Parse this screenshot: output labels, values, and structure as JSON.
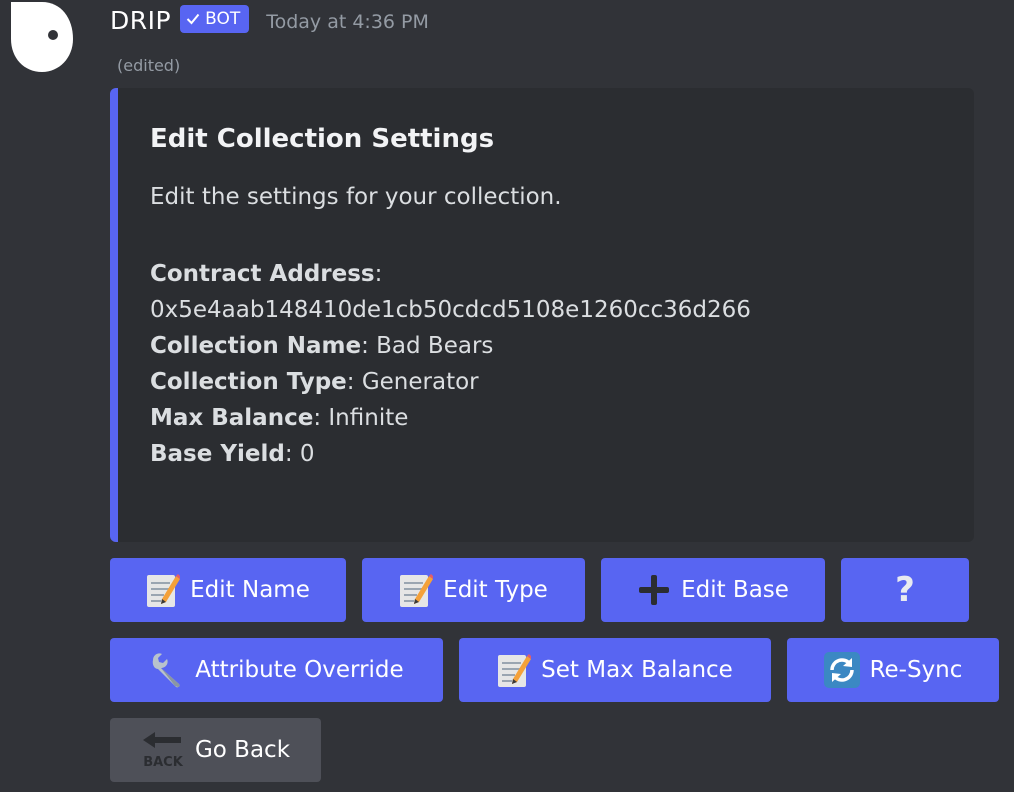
{
  "message": {
    "username": "DRIP",
    "bot_tag": "BOT",
    "timestamp": "Today at 4:36 PM",
    "edited": "(edited)"
  },
  "embed": {
    "accent_color": "#5865f2",
    "title": "Edit Collection Settings",
    "description": "Edit the settings for your collection.",
    "fields": [
      {
        "label": "Contract Address",
        "value": "0x5e4aab148410de1cb50cdcd5108e1260cc36d266"
      },
      {
        "label": "Collection Name",
        "value": "Bad Bears"
      },
      {
        "label": "Collection Type",
        "value": "Generator"
      },
      {
        "label": "Max Balance",
        "value": "Infinite"
      },
      {
        "label": "Base Yield",
        "value": "0"
      }
    ]
  },
  "buttons": {
    "edit_name": {
      "label": "Edit Name",
      "icon": "memo-icon"
    },
    "edit_type": {
      "label": "Edit Type",
      "icon": "memo-icon"
    },
    "edit_base": {
      "label": "Edit Base",
      "icon": "plus-icon"
    },
    "help": {
      "label": "?",
      "icon": "question-icon"
    },
    "attribute_override": {
      "label": "Attribute Override",
      "icon": "wrench-icon"
    },
    "set_max_balance": {
      "label": "Set Max Balance",
      "icon": "memo-icon"
    },
    "resync": {
      "label": "Re-Sync",
      "icon": "arrows-refresh-icon"
    },
    "go_back": {
      "label": "Go Back",
      "icon": "back-arrow-icon",
      "icon_text": "BACK"
    }
  },
  "colors": {
    "background": "#313338",
    "embed_bg": "#2b2d31",
    "primary_button": "#5865f2",
    "secondary_button": "#4e5058"
  }
}
